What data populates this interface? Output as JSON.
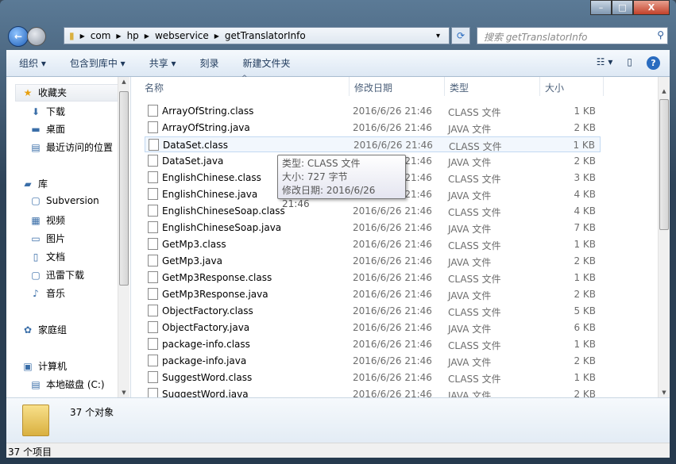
{
  "window": {
    "minimize": "–",
    "maximize": "□",
    "close": "X"
  },
  "address": {
    "crumbs": [
      "com",
      "hp",
      "webservice",
      "getTranslatorInfo"
    ]
  },
  "search": {
    "placeholder": "搜索 getTranslatorInfo"
  },
  "toolbar": {
    "organize": "组织 ▾",
    "include": "包含到库中 ▾",
    "share": "共享 ▾",
    "burn": "刻录",
    "new_folder": "新建文件夹"
  },
  "nav": {
    "items": [
      {
        "label": "收藏夹",
        "icon": "star-icon",
        "glyph": "★"
      },
      {
        "label": "下载",
        "icon": "downloads-icon",
        "glyph": "⬇"
      },
      {
        "label": "桌面",
        "icon": "desktop-icon",
        "glyph": "▬"
      },
      {
        "label": "最近访问的位置",
        "icon": "recent-places-icon",
        "glyph": "▤"
      },
      {
        "label": "库",
        "icon": "libraries-icon",
        "glyph": "▰"
      },
      {
        "label": "Subversion",
        "icon": "library-icon",
        "glyph": "▢"
      },
      {
        "label": "视频",
        "icon": "video-icon",
        "glyph": "▦"
      },
      {
        "label": "图片",
        "icon": "pictures-icon",
        "glyph": "▭"
      },
      {
        "label": "文档",
        "icon": "documents-icon",
        "glyph": "▯"
      },
      {
        "label": "迅雷下载",
        "icon": "library-icon",
        "glyph": "▢"
      },
      {
        "label": "音乐",
        "icon": "music-icon",
        "glyph": "♪"
      },
      {
        "label": "家庭组",
        "icon": "homegroup-icon",
        "glyph": "✿"
      },
      {
        "label": "计算机",
        "icon": "computer-icon",
        "glyph": "▣"
      },
      {
        "label": "本地磁盘 (C:)",
        "icon": "drive-icon",
        "glyph": "▤"
      }
    ]
  },
  "columns": {
    "name": "名称",
    "date": "修改日期",
    "type": "类型",
    "size": "大小"
  },
  "files": [
    {
      "name": "ArrayOfString.class",
      "date": "2016/6/26 21:46",
      "type": "CLASS 文件",
      "size": "1 KB"
    },
    {
      "name": "ArrayOfString.java",
      "date": "2016/6/26 21:46",
      "type": "JAVA 文件",
      "size": "2 KB"
    },
    {
      "name": "DataSet.class",
      "date": "2016/6/26 21:46",
      "type": "CLASS 文件",
      "size": "1 KB"
    },
    {
      "name": "DataSet.java",
      "date": "2016/6/26 21:46",
      "type": "JAVA 文件",
      "size": "2 KB"
    },
    {
      "name": "EnglishChinese.class",
      "date": "2016/6/26 21:46",
      "type": "CLASS 文件",
      "size": "3 KB"
    },
    {
      "name": "EnglishChinese.java",
      "date": "2016/6/26 21:46",
      "type": "JAVA 文件",
      "size": "4 KB"
    },
    {
      "name": "EnglishChineseSoap.class",
      "date": "2016/6/26 21:46",
      "type": "CLASS 文件",
      "size": "4 KB"
    },
    {
      "name": "EnglishChineseSoap.java",
      "date": "2016/6/26 21:46",
      "type": "JAVA 文件",
      "size": "7 KB"
    },
    {
      "name": "GetMp3.class",
      "date": "2016/6/26 21:46",
      "type": "CLASS 文件",
      "size": "1 KB"
    },
    {
      "name": "GetMp3.java",
      "date": "2016/6/26 21:46",
      "type": "JAVA 文件",
      "size": "2 KB"
    },
    {
      "name": "GetMp3Response.class",
      "date": "2016/6/26 21:46",
      "type": "CLASS 文件",
      "size": "1 KB"
    },
    {
      "name": "GetMp3Response.java",
      "date": "2016/6/26 21:46",
      "type": "JAVA 文件",
      "size": "2 KB"
    },
    {
      "name": "ObjectFactory.class",
      "date": "2016/6/26 21:46",
      "type": "CLASS 文件",
      "size": "5 KB"
    },
    {
      "name": "ObjectFactory.java",
      "date": "2016/6/26 21:46",
      "type": "JAVA 文件",
      "size": "6 KB"
    },
    {
      "name": "package-info.class",
      "date": "2016/6/26 21:46",
      "type": "CLASS 文件",
      "size": "1 KB"
    },
    {
      "name": "package-info.java",
      "date": "2016/6/26 21:46",
      "type": "JAVA 文件",
      "size": "2 KB"
    },
    {
      "name": "SuggestWord.class",
      "date": "2016/6/26 21:46",
      "type": "CLASS 文件",
      "size": "1 KB"
    },
    {
      "name": "SuggestWord.java",
      "date": "2016/6/26 21:46",
      "type": "JAVA 文件",
      "size": "2 KB"
    }
  ],
  "tooltip": {
    "type": "类型: CLASS 文件",
    "size": "大小: 727 字节",
    "date": "修改日期: 2016/6/26 21:46"
  },
  "details": {
    "count": "37 个对象"
  },
  "status": {
    "text": "37 个项目"
  }
}
